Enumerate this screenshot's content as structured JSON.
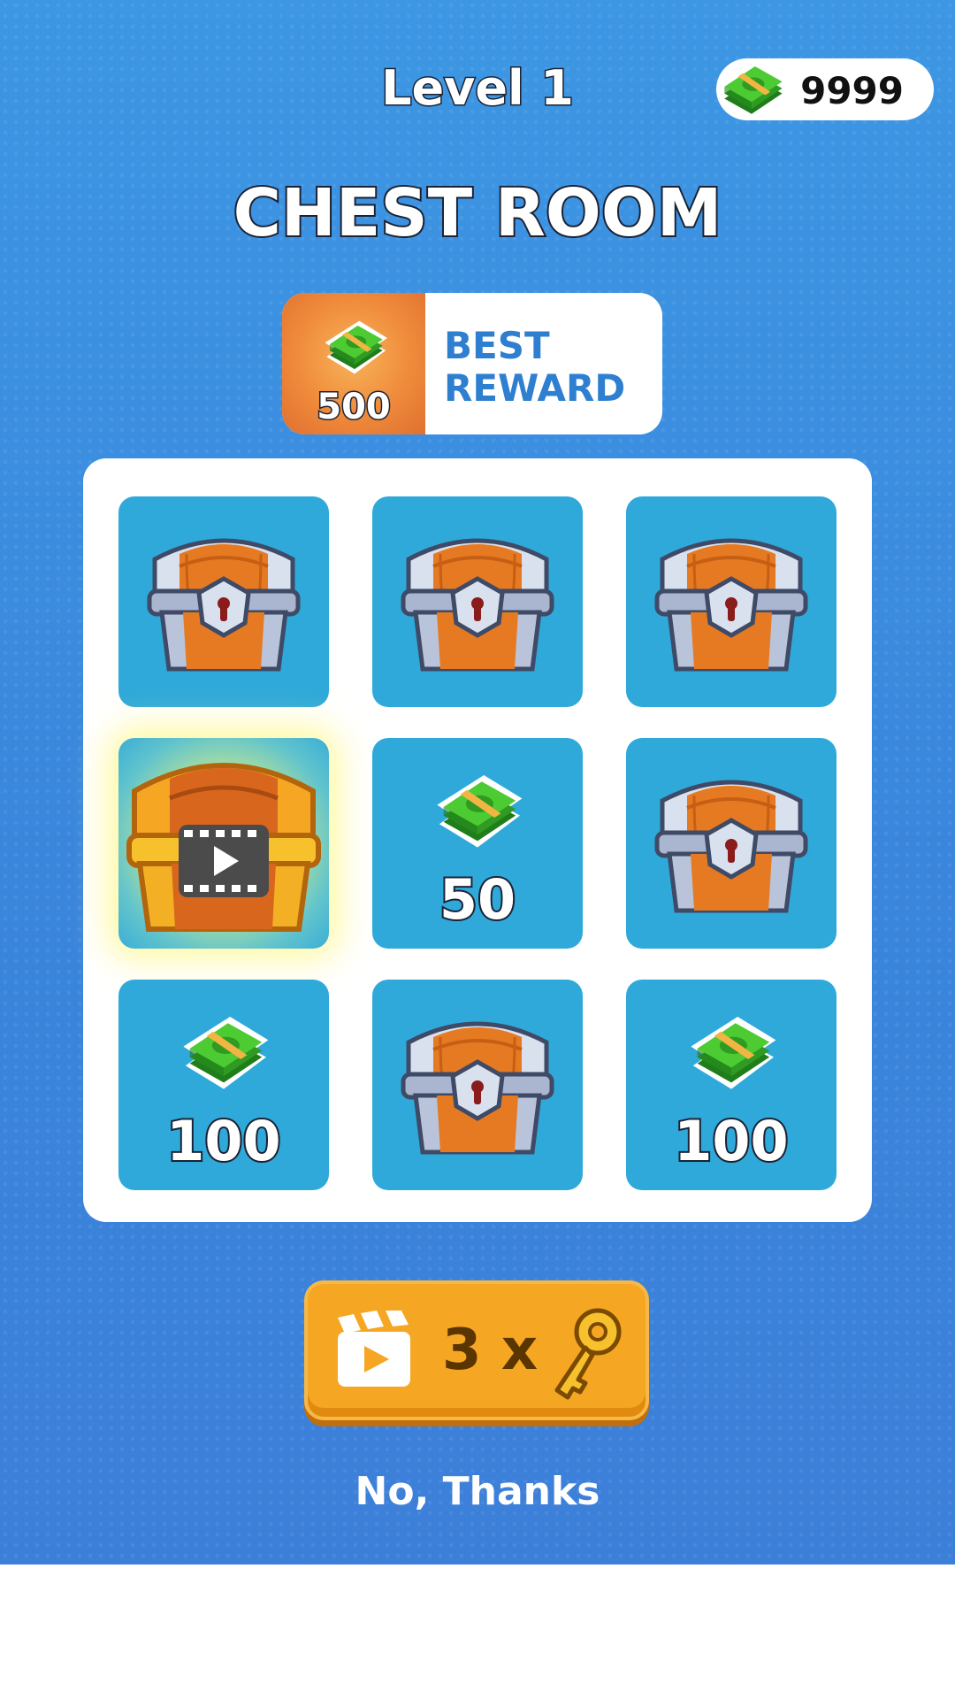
{
  "header": {
    "level_title": "Level 1",
    "currency": {
      "value": "9999",
      "icon": "cash-stack-icon"
    }
  },
  "page_title": "CHEST ROOM",
  "best_reward": {
    "amount": "500",
    "label_line1": "BEST",
    "label_line2": "REWARD",
    "icon": "cash-stack-icon"
  },
  "grid": {
    "tiles": [
      {
        "type": "chest"
      },
      {
        "type": "chest"
      },
      {
        "type": "chest"
      },
      {
        "type": "video-chest"
      },
      {
        "type": "cash",
        "amount": "50"
      },
      {
        "type": "chest"
      },
      {
        "type": "cash",
        "amount": "100"
      },
      {
        "type": "chest"
      },
      {
        "type": "cash",
        "amount": "100"
      }
    ]
  },
  "ad_button": {
    "count": "3 x",
    "icons": [
      "video-clapper-icon",
      "key-icon"
    ]
  },
  "no_thanks_label": "No, Thanks",
  "colors": {
    "background": "#3a8ae0",
    "tile": "#2fa9da",
    "button": "#f5a623",
    "reward_accent": "#2f7fd0",
    "cash_green": "#3fbf2a"
  }
}
